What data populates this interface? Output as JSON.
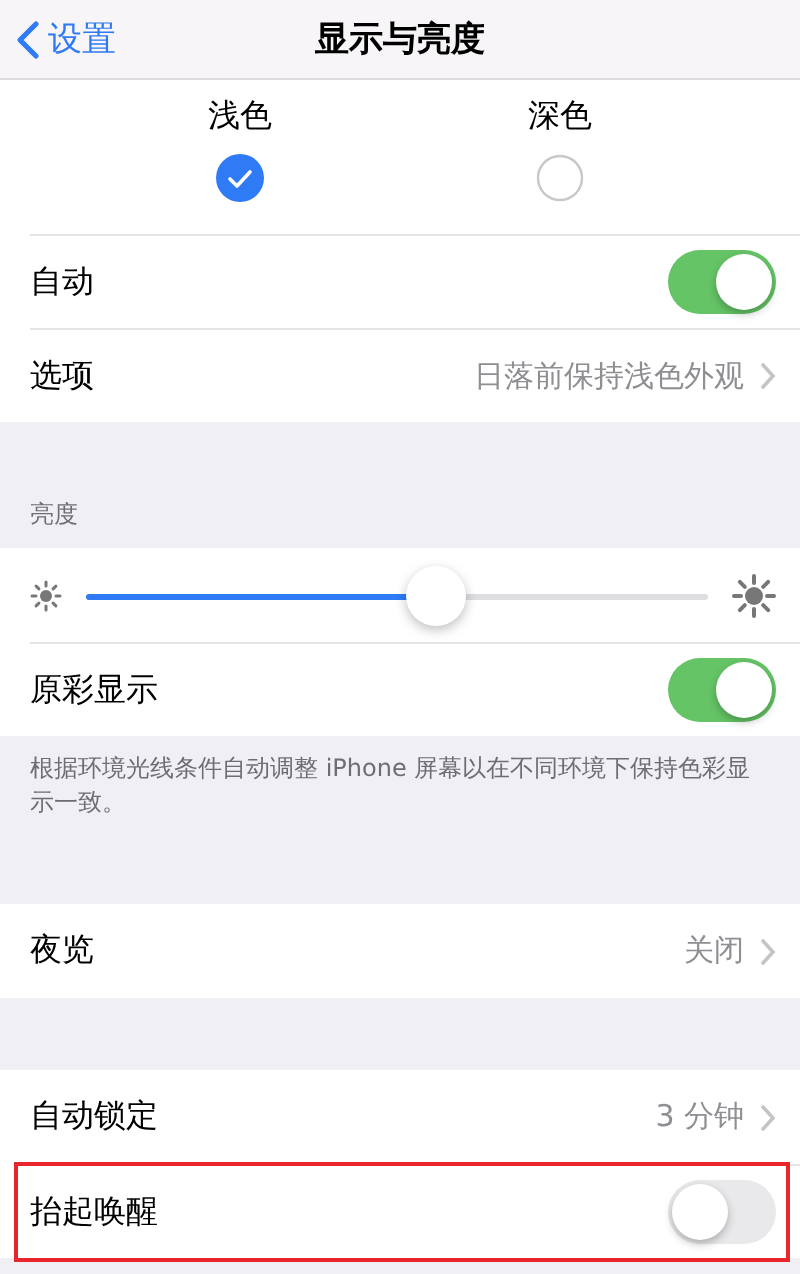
{
  "nav": {
    "back": "设置",
    "title": "显示与亮度"
  },
  "sections": [
    {
      "appearance": [
        {
          "label": "浅色",
          "selected": true
        },
        {
          "label": "深色",
          "selected": false
        }
      ],
      "rows": [
        {
          "kind": "toggle",
          "label": "自动",
          "on": true
        },
        {
          "kind": "link",
          "label": "选项",
          "value": "日落前保持浅色外观"
        }
      ]
    },
    {
      "header": "亮度",
      "rows": [
        {
          "kind": "slider",
          "level": 0.57
        },
        {
          "kind": "toggle",
          "label": "原彩显示",
          "on": true
        }
      ],
      "footer": "根据环境光线条件自动调整 iPhone 屏幕以在不同环境下保持色彩显示一致。"
    },
    {
      "rows": [
        {
          "kind": "link",
          "label": "夜览",
          "value": "关闭"
        }
      ]
    },
    {
      "rows": [
        {
          "kind": "link",
          "label": "自动锁定",
          "value": "3 分钟"
        },
        {
          "kind": "toggle",
          "label": "抬起唤醒",
          "on": false,
          "highlighted": true
        }
      ]
    }
  ]
}
